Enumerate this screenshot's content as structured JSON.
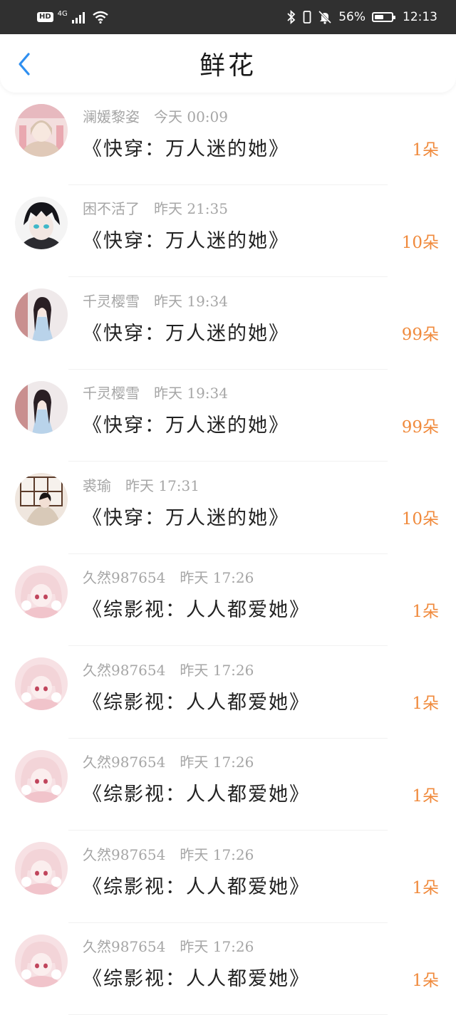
{
  "status_bar": {
    "hd": "HD",
    "network": "4G",
    "battery": "56%",
    "battery_level": 0.56,
    "time": "12:13"
  },
  "header": {
    "title": "鲜花",
    "back_icon": "chevron-left-icon",
    "accent": "#2f8ff0"
  },
  "colors": {
    "count": "#f08a3c",
    "meta": "#a6a6a6",
    "status_bar": "#303030"
  },
  "rows": [
    {
      "user": "澜媛黎姿",
      "time": "今天 00:09",
      "book": "《快穿：万人迷的她》",
      "count": "1朵",
      "avatar": "avatar-pink-portrait"
    },
    {
      "user": "困不活了",
      "time": "昨天 21:35",
      "book": "《快穿：万人迷的她》",
      "count": "10朵",
      "avatar": "avatar-dark-anime"
    },
    {
      "user": "千灵樱雪",
      "time": "昨天 19:34",
      "book": "《快穿：万人迷的她》",
      "count": "99朵",
      "avatar": "avatar-blue-dress"
    },
    {
      "user": "千灵樱雪",
      "time": "昨天 19:34",
      "book": "《快穿：万人迷的她》",
      "count": "99朵",
      "avatar": "avatar-blue-dress"
    },
    {
      "user": "裘瑜",
      "time": "昨天 17:31",
      "book": "《快穿：万人迷的她》",
      "count": "10朵",
      "avatar": "avatar-window-girl"
    },
    {
      "user": "久然987654",
      "time": "昨天 17:26",
      "book": "《综影视：人人都爱她》",
      "count": "1朵",
      "avatar": "avatar-pink-anime"
    },
    {
      "user": "久然987654",
      "time": "昨天 17:26",
      "book": "《综影视：人人都爱她》",
      "count": "1朵",
      "avatar": "avatar-pink-anime"
    },
    {
      "user": "久然987654",
      "time": "昨天 17:26",
      "book": "《综影视：人人都爱她》",
      "count": "1朵",
      "avatar": "avatar-pink-anime"
    },
    {
      "user": "久然987654",
      "time": "昨天 17:26",
      "book": "《综影视：人人都爱她》",
      "count": "1朵",
      "avatar": "avatar-pink-anime"
    },
    {
      "user": "久然987654",
      "time": "昨天 17:26",
      "book": "《综影视：人人都爱她》",
      "count": "1朵",
      "avatar": "avatar-pink-anime"
    }
  ]
}
